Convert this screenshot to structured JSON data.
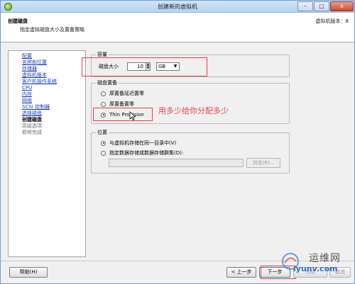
{
  "window": {
    "title": "创建新的虚拟机",
    "controls": {
      "minimize": "–",
      "maximize": "□",
      "close": "x"
    }
  },
  "header": {
    "title": "创建磁盘",
    "subtitle": "指定虚拟磁盘大小及置备策略",
    "version": "虚拟机版本：8"
  },
  "nav": {
    "items": [
      {
        "label": "配置",
        "state": "done"
      },
      {
        "label": "名称和位置",
        "state": "done"
      },
      {
        "label": "存储器",
        "state": "done"
      },
      {
        "label": "虚拟机版本",
        "state": "done"
      },
      {
        "label": "客户机操作系统",
        "state": "done"
      },
      {
        "label": "CPU",
        "state": "done"
      },
      {
        "label": "内存",
        "state": "done"
      },
      {
        "label": "网络",
        "state": "done"
      },
      {
        "label": "SCSI 控制器",
        "state": "done"
      },
      {
        "label": "选择磁盘",
        "state": "done"
      },
      {
        "label": "创建磁盘",
        "state": "current"
      },
      {
        "label": "高级选项",
        "state": "pending"
      },
      {
        "label": "即将完成",
        "state": "pending"
      }
    ]
  },
  "capacity": {
    "legend": "容量",
    "disk_size_label": "磁盘大小",
    "disk_size_value": "10",
    "unit_value": "GB"
  },
  "provisioning": {
    "legend": "磁盘置备",
    "options": [
      {
        "label": "厚置备延迟置零",
        "checked": false
      },
      {
        "label": "厚置备置零",
        "checked": false
      },
      {
        "label": "Thin Provision",
        "checked": true
      }
    ]
  },
  "location": {
    "legend": "位置",
    "options": [
      {
        "label": "与虚拟机存储在同一目录中(V)",
        "checked": true
      },
      {
        "label": "指定数据存储或数据存储群集(D):",
        "checked": false
      }
    ],
    "browse_label": "浏览(R)..."
  },
  "annotation": {
    "text": "用多少给你分配多少",
    "color": "#e8434f"
  },
  "footer": {
    "help_label": "帮助(H)",
    "back_label": "< 上一步",
    "next_label": "下一步",
    "finish_label": "完成",
    "cancel_label": "取消"
  },
  "watermark": {
    "cn_text": "运维网",
    "url_text": "iyunv.com"
  },
  "colors": {
    "link": "#1a3fb5",
    "annotation": "#e8434f",
    "title_bar": "#b9d3ef"
  }
}
